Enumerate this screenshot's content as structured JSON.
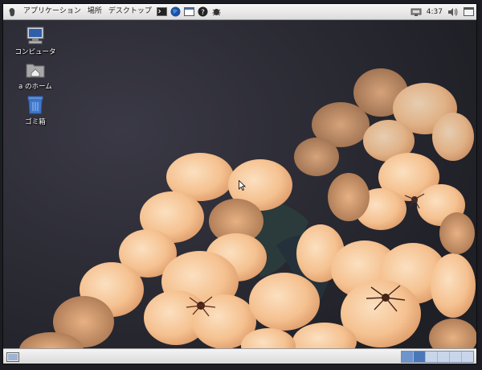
{
  "top_panel": {
    "menus": [
      "アプリケーション",
      "場所",
      "デスクトップ"
    ],
    "launchers": [
      "terminal-icon",
      "web-browser-icon",
      "file-manager-icon",
      "help-icon",
      "bug-report-icon"
    ],
    "tray": {
      "network_icon": "network-icon",
      "clock": "4:37",
      "volume_icon": "volume-icon",
      "window_icon": "window-list-icon"
    }
  },
  "desktop": {
    "icons": [
      {
        "label": "コンピュータ",
        "icon": "computer-icon"
      },
      {
        "label": "a のホーム",
        "icon": "home-folder-icon"
      },
      {
        "label": "ゴミ箱",
        "icon": "trash-icon"
      }
    ]
  },
  "bottom_panel": {
    "show_desktop_icon": "show-desktop-icon",
    "workspace_count": 4,
    "active_workspace": 2
  },
  "colors": {
    "panel": "#e6e6e6",
    "workspace_active": "#4b77b8",
    "flower": "#f6c79a",
    "background": "#2a2a33"
  }
}
